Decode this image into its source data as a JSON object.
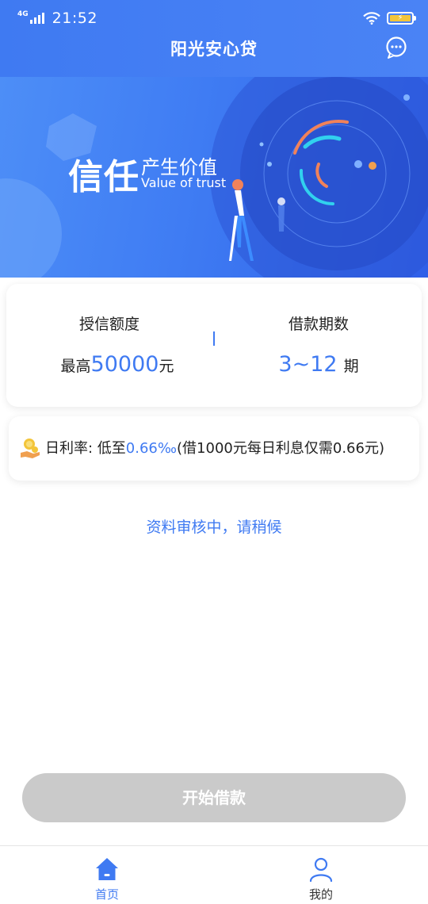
{
  "status_bar": {
    "network": "4G",
    "time": "21:52"
  },
  "header": {
    "title": "阳光安心贷"
  },
  "banner": {
    "big_text": "信任",
    "sub_text": "产生价值",
    "english_text": "Value of trust"
  },
  "credit": {
    "limit_title": "授信额度",
    "limit_prefix": "最高",
    "limit_value": "50000",
    "limit_unit": "元",
    "term_title": "借款期数",
    "term_value": "3~12",
    "term_unit": "期"
  },
  "rate": {
    "label": "日利率: 低至",
    "value": "0.66‰",
    "note": "(借1000元每日利息仅需0.66元)"
  },
  "review_status": "资料审核中，请稍候",
  "start_button": {
    "label": "开始借款",
    "enabled": false
  },
  "tabbar": {
    "items": [
      {
        "label": "首页",
        "icon": "home-icon",
        "active": true
      },
      {
        "label": "我的",
        "icon": "user-icon",
        "active": false
      }
    ]
  },
  "colors": {
    "accent": "#3f7af2",
    "disabled_button": "#cacaca",
    "battery": "#f3c53a"
  }
}
